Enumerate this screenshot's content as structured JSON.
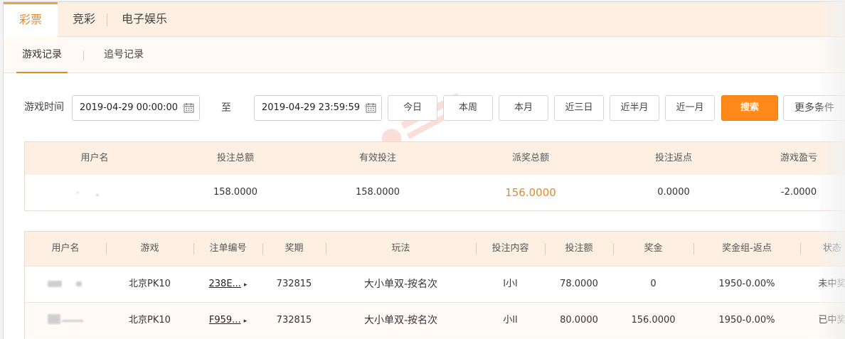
{
  "top_tabs": [
    {
      "label": "彩票",
      "active": true
    },
    {
      "label": "竞彩",
      "active": false
    },
    {
      "label": "电子娱乐",
      "active": false
    }
  ],
  "sub_tabs": [
    {
      "label": "游戏记录",
      "active": true
    },
    {
      "label": "追号记录",
      "active": false
    }
  ],
  "filter": {
    "time_label": "游戏时间",
    "start": "2019-04-29 00:00:00",
    "to_label": "至",
    "end": "2019-04-29 23:59:59",
    "quick_ranges": [
      "今日",
      "本周",
      "本月",
      "近三日",
      "近半月",
      "近一月"
    ],
    "search_label": "搜索",
    "more_label": "更多条件"
  },
  "summary": {
    "headers": [
      "用户名",
      "投注总额",
      "有效投注",
      "派奖总额",
      "投注返点",
      "游戏盈亏"
    ],
    "row": {
      "bet_total": "158.0000",
      "valid_bet": "158.0000",
      "payout_total": "156.0000",
      "rebate": "0.0000",
      "profit": "-2.0000"
    }
  },
  "details": {
    "headers": [
      "用户名",
      "游戏",
      "注单编号",
      "奖期",
      "玩法",
      "投注内容",
      "投注额",
      "奖金",
      "奖金组-返点",
      "状态"
    ],
    "rows": [
      {
        "game": "北京PK10",
        "order_no": "238E...",
        "period": "732815",
        "play": "大小单双-按名次",
        "content": "l小l",
        "amount": "78.0000",
        "prize": "0",
        "group_rebate": "1950-0.00%",
        "status": "未中奖"
      },
      {
        "game": "北京PK10",
        "order_no": "F959...",
        "period": "732815",
        "play": "大小单双-按名次",
        "content": "小ll",
        "amount": "80.0000",
        "prize": "156.0000",
        "group_rebate": "1950-0.00%",
        "status": "已中奖"
      }
    ]
  },
  "colors": {
    "accent": "#e08a2e",
    "primary_button": "#ff8a1a",
    "header_bg": "#fdf0e3"
  },
  "icons": {
    "calendar": "calendar-icon",
    "arrow": "caret-right-icon"
  }
}
